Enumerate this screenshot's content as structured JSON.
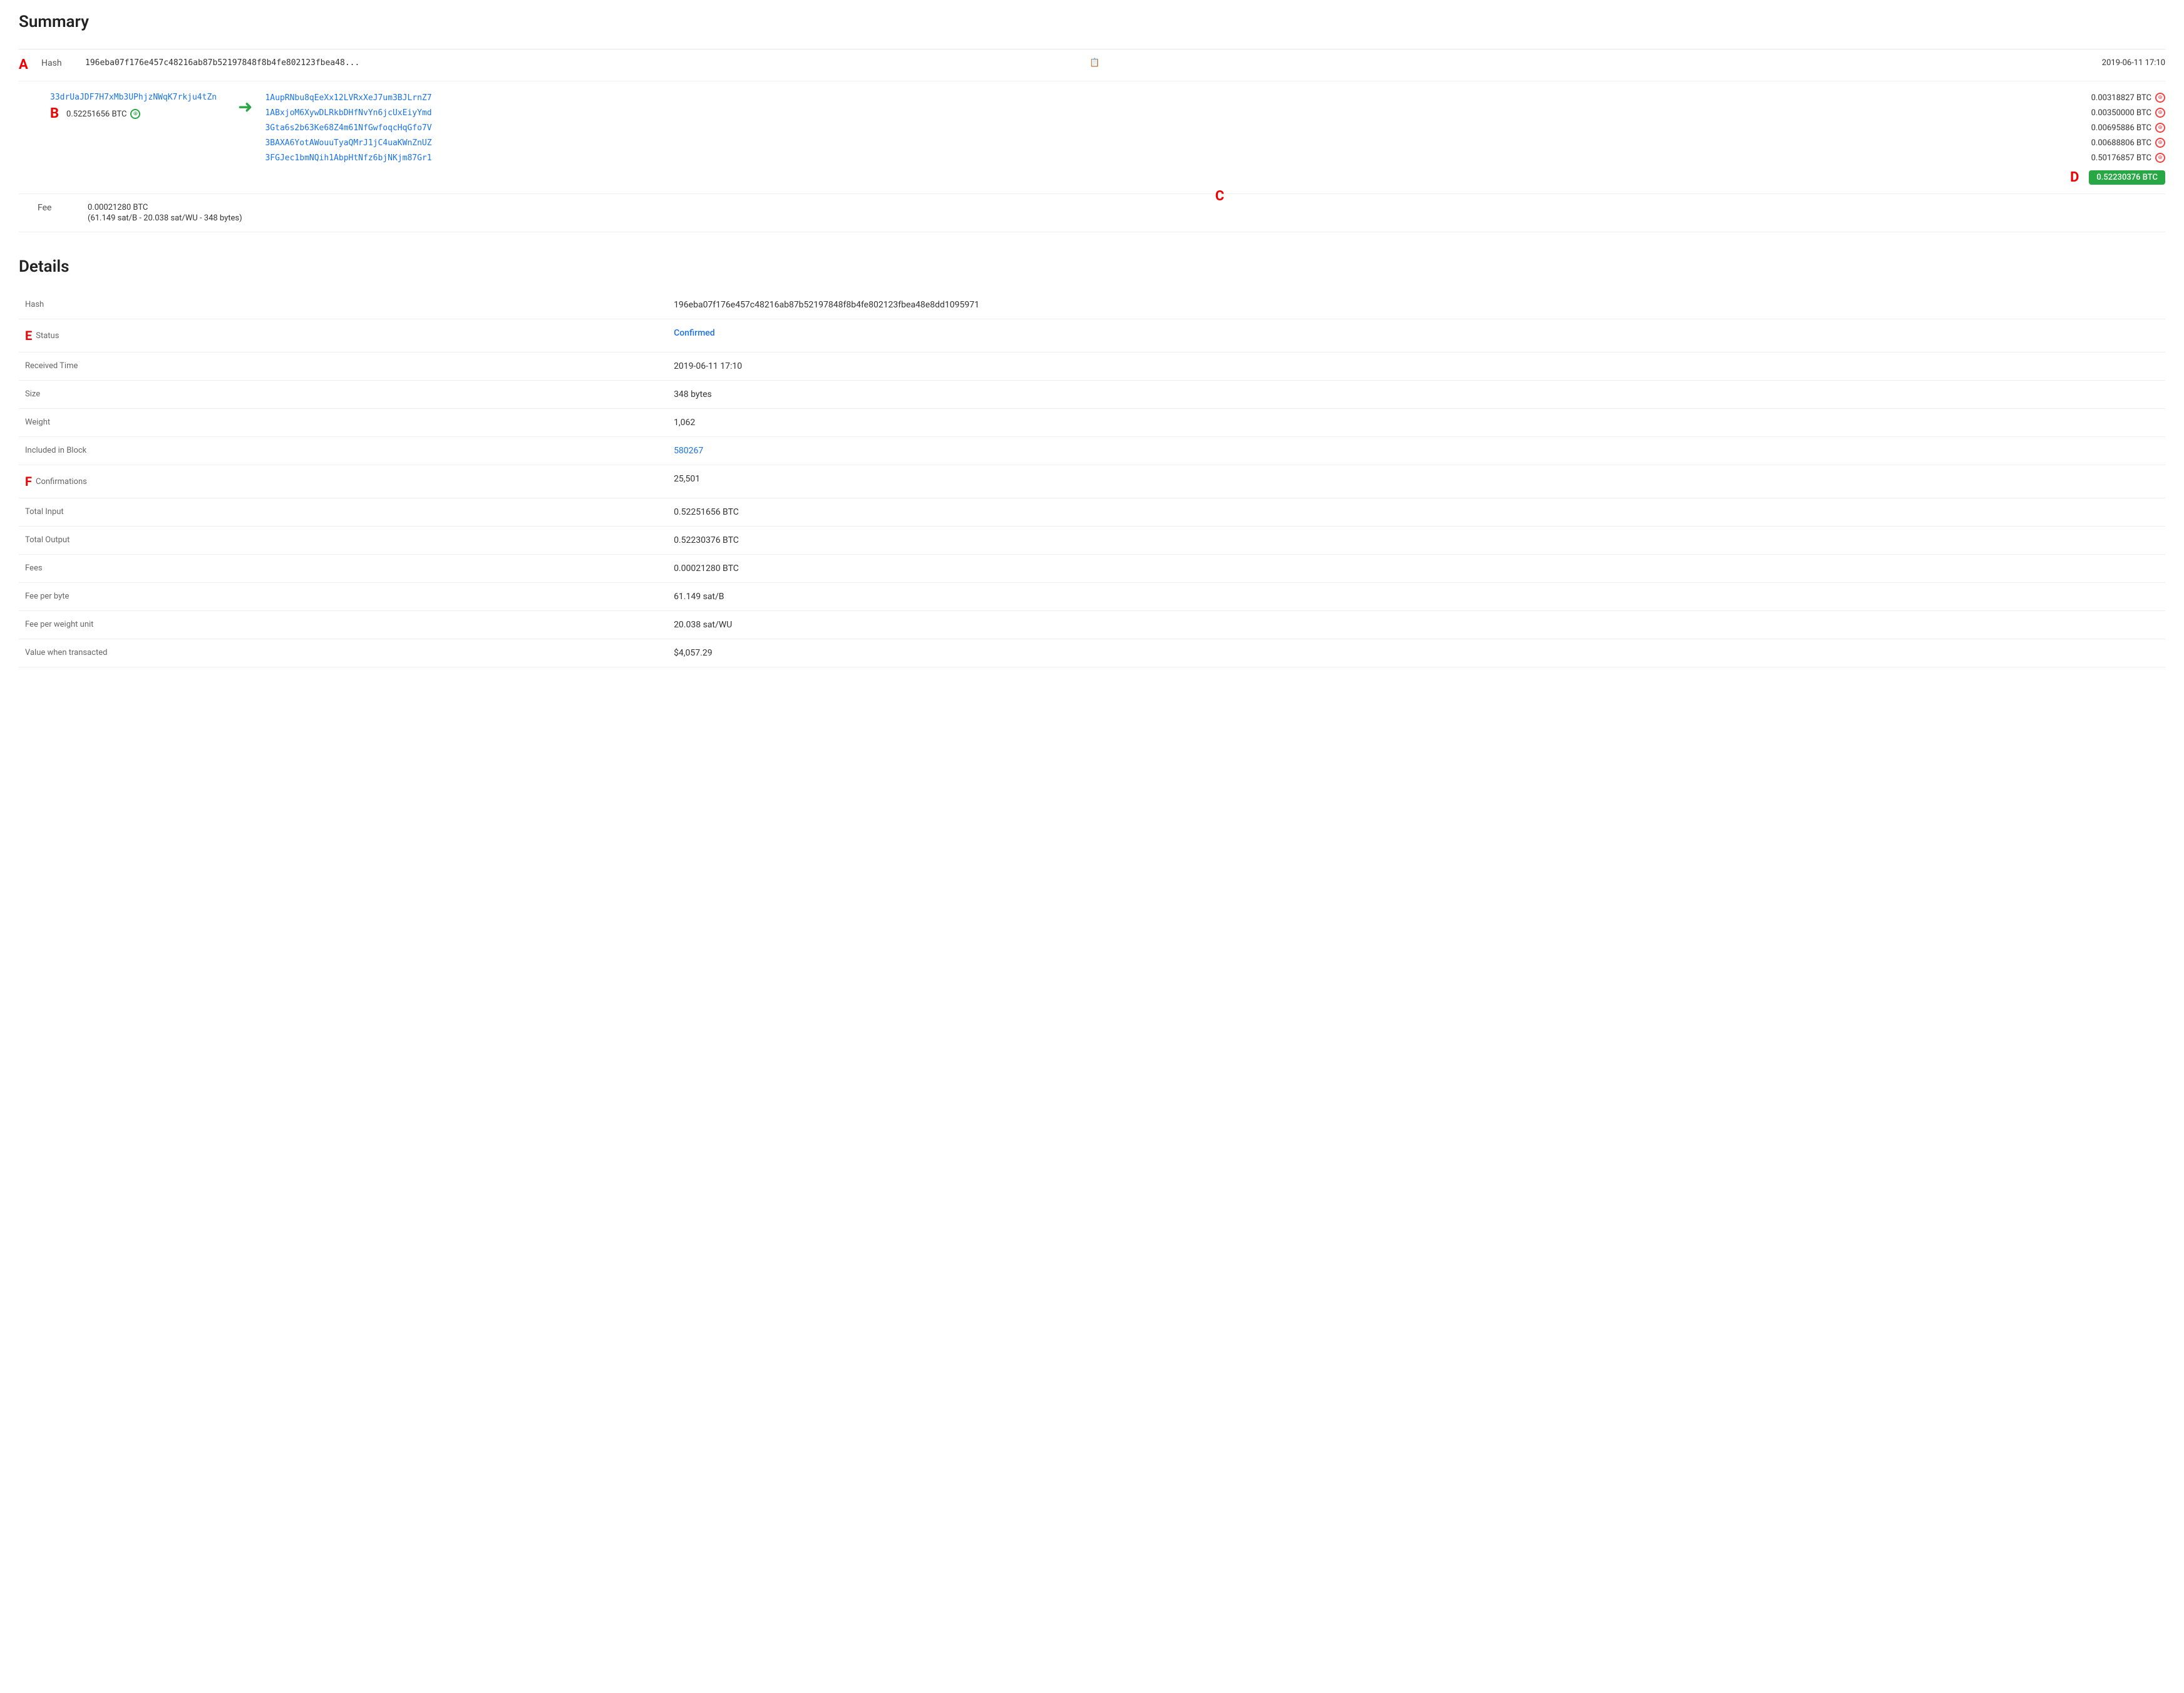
{
  "summary": {
    "title": "Summary",
    "hash_short": "196eba07f176e457c48216ab87b52197848f8b4fe802123fbea48...",
    "hash_full": "196eba07f176e457c48216ab87b52197848f8b4fe802123fbea48e8dd1095971",
    "copy_icon": "📋",
    "timestamp": "2019-06-11 17:10",
    "input_address": "33drUaJDF7H7xMb3UPhjzNWqK7rkju4tZn",
    "input_amount": "0.52251656 BTC",
    "outputs": [
      {
        "address": "1AupRNbu8qEeXx12LVRxXeJ7um3BJLrnZ7",
        "amount": "0.00318827 BTC"
      },
      {
        "address": "1ABxjoM6XywDLRkbDHfNvYn6jcUxEiyYmd",
        "amount": "0.00350000 BTC"
      },
      {
        "address": "3Gta6s2b63Ke68Z4m61NfGwfoqcHqGfo7V",
        "amount": "0.00695886 BTC"
      },
      {
        "address": "3BAXA6YotAWouuTyaQMrJ1jC4uaKWnZnUZ",
        "amount": "0.00688806 BTC"
      },
      {
        "address": "3FGJec1bmNQih1AbpHtNfz6bjNKjm87Gr1",
        "amount": "0.50176857 BTC"
      }
    ],
    "total_output": "0.52230376 BTC",
    "fee_label": "Fee",
    "fee_amount": "0.00021280 BTC",
    "fee_detail": "(61.149 sat/B - 20.038 sat/WU - 348 bytes)"
  },
  "details": {
    "title": "Details",
    "rows": [
      {
        "label": "Hash",
        "value": "196eba07f176e457c48216ab87b52197848f8b4fe802123fbea48e8dd1095971",
        "type": "text"
      },
      {
        "label": "Status",
        "value": "Confirmed",
        "type": "confirmed"
      },
      {
        "label": "Received Time",
        "value": "2019-06-11 17:10",
        "type": "text"
      },
      {
        "label": "Size",
        "value": "348 bytes",
        "type": "text"
      },
      {
        "label": "Weight",
        "value": "1,062",
        "type": "text"
      },
      {
        "label": "Included in Block",
        "value": "580267",
        "type": "link"
      },
      {
        "label": "Confirmations",
        "value": "25,501",
        "type": "text"
      },
      {
        "label": "Total Input",
        "value": "0.52251656 BTC",
        "type": "text"
      },
      {
        "label": "Total Output",
        "value": "0.52230376 BTC",
        "type": "text"
      },
      {
        "label": "Fees",
        "value": "0.00021280 BTC",
        "type": "text"
      },
      {
        "label": "Fee per byte",
        "value": "61.149 sat/B",
        "type": "text"
      },
      {
        "label": "Fee per weight unit",
        "value": "20.038 sat/WU",
        "type": "text"
      },
      {
        "label": "Value when transacted",
        "value": "$4,057.29",
        "type": "text"
      }
    ]
  },
  "annotations": {
    "A": "A",
    "B": "B",
    "C": "C",
    "D": "D",
    "E": "E",
    "F": "F"
  },
  "colors": {
    "link": "#1a73e8",
    "confirmed": "#1a73e8",
    "arrow": "#28a745",
    "total_bg": "#28a745",
    "annotation": "#e00000"
  }
}
